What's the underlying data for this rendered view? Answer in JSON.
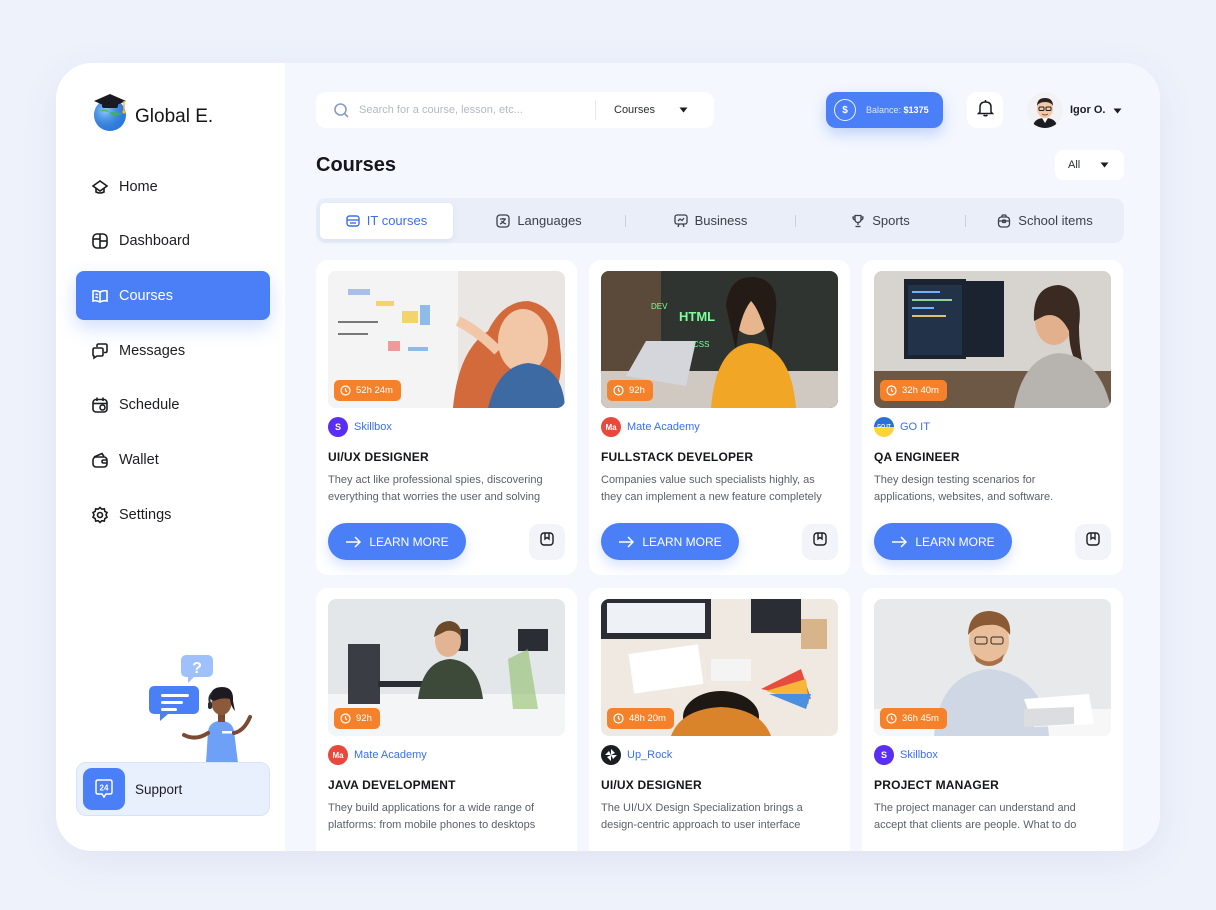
{
  "app": {
    "name": "Global E."
  },
  "nav": [
    {
      "label": "Home",
      "icon": "home-icon"
    },
    {
      "label": "Dashboard",
      "icon": "dashboard-icon"
    },
    {
      "label": "Courses",
      "icon": "book-icon",
      "active": true
    },
    {
      "label": "Messages",
      "icon": "messages-icon"
    },
    {
      "label": "Schedule",
      "icon": "calendar-icon"
    },
    {
      "label": "Wallet",
      "icon": "wallet-icon"
    },
    {
      "label": "Settings",
      "icon": "gear-icon"
    }
  ],
  "support": {
    "label": "Support",
    "badge": "24"
  },
  "search": {
    "placeholder": "Search for a course, lesson, etc...",
    "category": "Courses"
  },
  "balance": {
    "label": "Balance:",
    "amount": "$1375"
  },
  "user": {
    "name": "Igor O."
  },
  "page": {
    "title": "Courses",
    "filter": "All"
  },
  "tabs": [
    {
      "label": "IT courses",
      "icon": "laptop-icon",
      "active": true
    },
    {
      "label": "Languages",
      "icon": "translate-icon"
    },
    {
      "label": "Business",
      "icon": "presentation-icon"
    },
    {
      "label": "Sports",
      "icon": "trophy-icon"
    },
    {
      "label": "School items",
      "icon": "backpack-icon"
    }
  ],
  "learn_label": "LEARN MORE",
  "courses": [
    {
      "duration": "52h 24m",
      "provider": "Skillbox",
      "provider_initial": "S",
      "provider_color": "#5b2ef5",
      "title": "UI/UX DESIGNER",
      "desc1": "They act like professional spies, discovering",
      "desc2": "everything that worries the user and solving"
    },
    {
      "duration": "92h",
      "provider": "Mate Academy",
      "provider_initial": "Ma",
      "provider_color": "#e9483b",
      "title": "FULLSTACK DEVELOPER",
      "desc1": "Companies value such specialists highly, as",
      "desc2": "they can implement a new feature completely"
    },
    {
      "duration": "32h 40m",
      "provider": "GO IT",
      "provider_initial": "GO IT",
      "provider_color": "#ffd43b",
      "title": "QA ENGINEER",
      "desc1": "They design testing scenarios for",
      "desc2": "applications, websites, and software."
    },
    {
      "duration": "92h",
      "provider": "Mate Academy",
      "provider_initial": "Ma",
      "provider_color": "#e9483b",
      "title": "JAVA DEVELOPMENT",
      "desc1": "They build applications for a wide range of",
      "desc2": "platforms: from mobile phones to desktops"
    },
    {
      "duration": "48h 20m",
      "provider": "Up_Rock",
      "provider_initial": "",
      "provider_color": "#1c1d22",
      "title": "UI/UX DESIGNER",
      "desc1": "The UI/UX Design Specialization brings a",
      "desc2": "design-centric approach to user interface"
    },
    {
      "duration": "36h 45m",
      "provider": "Skillbox",
      "provider_initial": "S",
      "provider_color": "#5b2ef5",
      "title": "PROJECT MANAGER",
      "desc1": "The project manager can understand and",
      "desc2": "accept that clients are people. What to do"
    }
  ],
  "colors": {
    "accent": "#4a7ff7",
    "duration_badge": "#f5822a",
    "background": "#eef2fb"
  }
}
